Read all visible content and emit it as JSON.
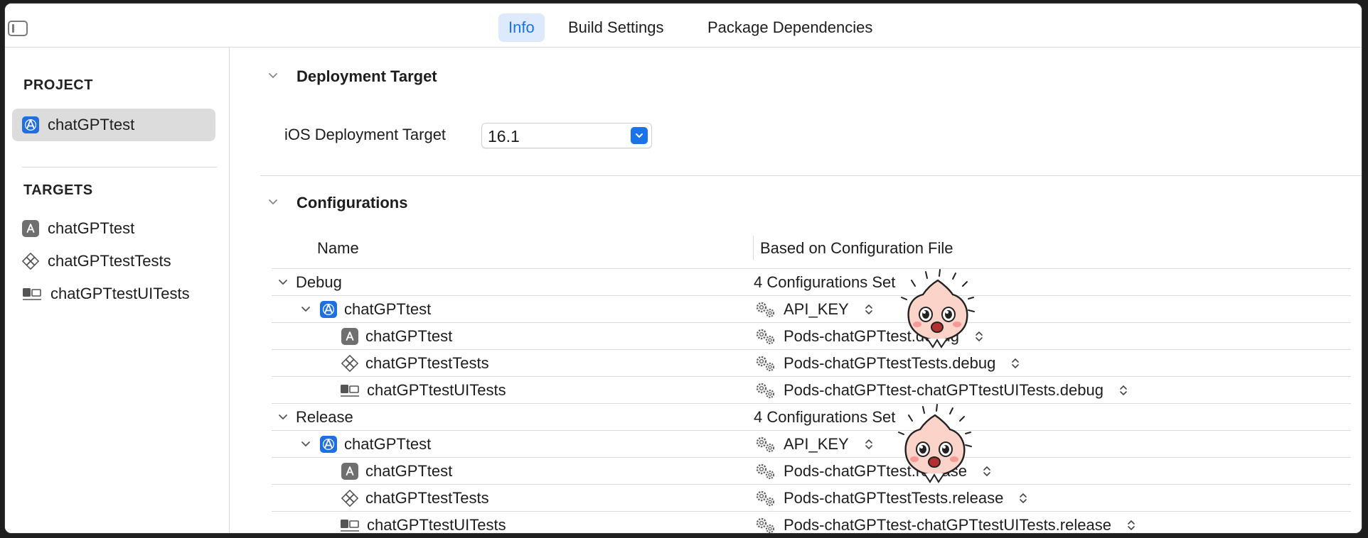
{
  "tabs": [
    {
      "label": "Info",
      "active": true
    },
    {
      "label": "Build Settings",
      "active": false
    },
    {
      "label": "Package Dependencies",
      "active": false
    }
  ],
  "sidebar": {
    "project_heading": "PROJECT",
    "project_item": "chatGPTtest",
    "targets_heading": "TARGETS",
    "targets": [
      {
        "label": "chatGPTtest",
        "icon": "app-target-icon"
      },
      {
        "label": "chatGPTtestTests",
        "icon": "unit-test-icon"
      },
      {
        "label": "chatGPTtestUITests",
        "icon": "ui-test-icon"
      }
    ]
  },
  "deployment": {
    "title": "Deployment Target",
    "label": "iOS Deployment Target",
    "value": "16.1"
  },
  "configurations": {
    "title": "Configurations",
    "col_name": "Name",
    "col_file": "Based on Configuration File",
    "groups": [
      {
        "name": "Debug",
        "summary": "4 Configurations Set",
        "project": {
          "label": "chatGPTtest",
          "file": "API_KEY"
        },
        "targets": [
          {
            "label": "chatGPTtest",
            "file": "Pods-chatGPTtest.debug"
          },
          {
            "label": "chatGPTtestTests",
            "file": "Pods-chatGPTtestTests.debug"
          },
          {
            "label": "chatGPTtestUITests",
            "file": "Pods-chatGPTtest-chatGPTtestUITests.debug"
          }
        ]
      },
      {
        "name": "Release",
        "summary": "4 Configurations Set",
        "project": {
          "label": "chatGPTtest",
          "file": "API_KEY"
        },
        "targets": [
          {
            "label": "chatGPTtest",
            "file": "Pods-chatGPTtest.release"
          },
          {
            "label": "chatGPTtestTests",
            "file": "Pods-chatGPTtestTests.release"
          },
          {
            "label": "chatGPTtestUITests",
            "file": "Pods-chatGPTtest-chatGPTtestUITests.release"
          }
        ]
      }
    ]
  },
  "colors": {
    "accent": "#1a73e8",
    "selected_tab_bg": "#dceafc",
    "sidebar_selected": "#dcdcdc"
  }
}
